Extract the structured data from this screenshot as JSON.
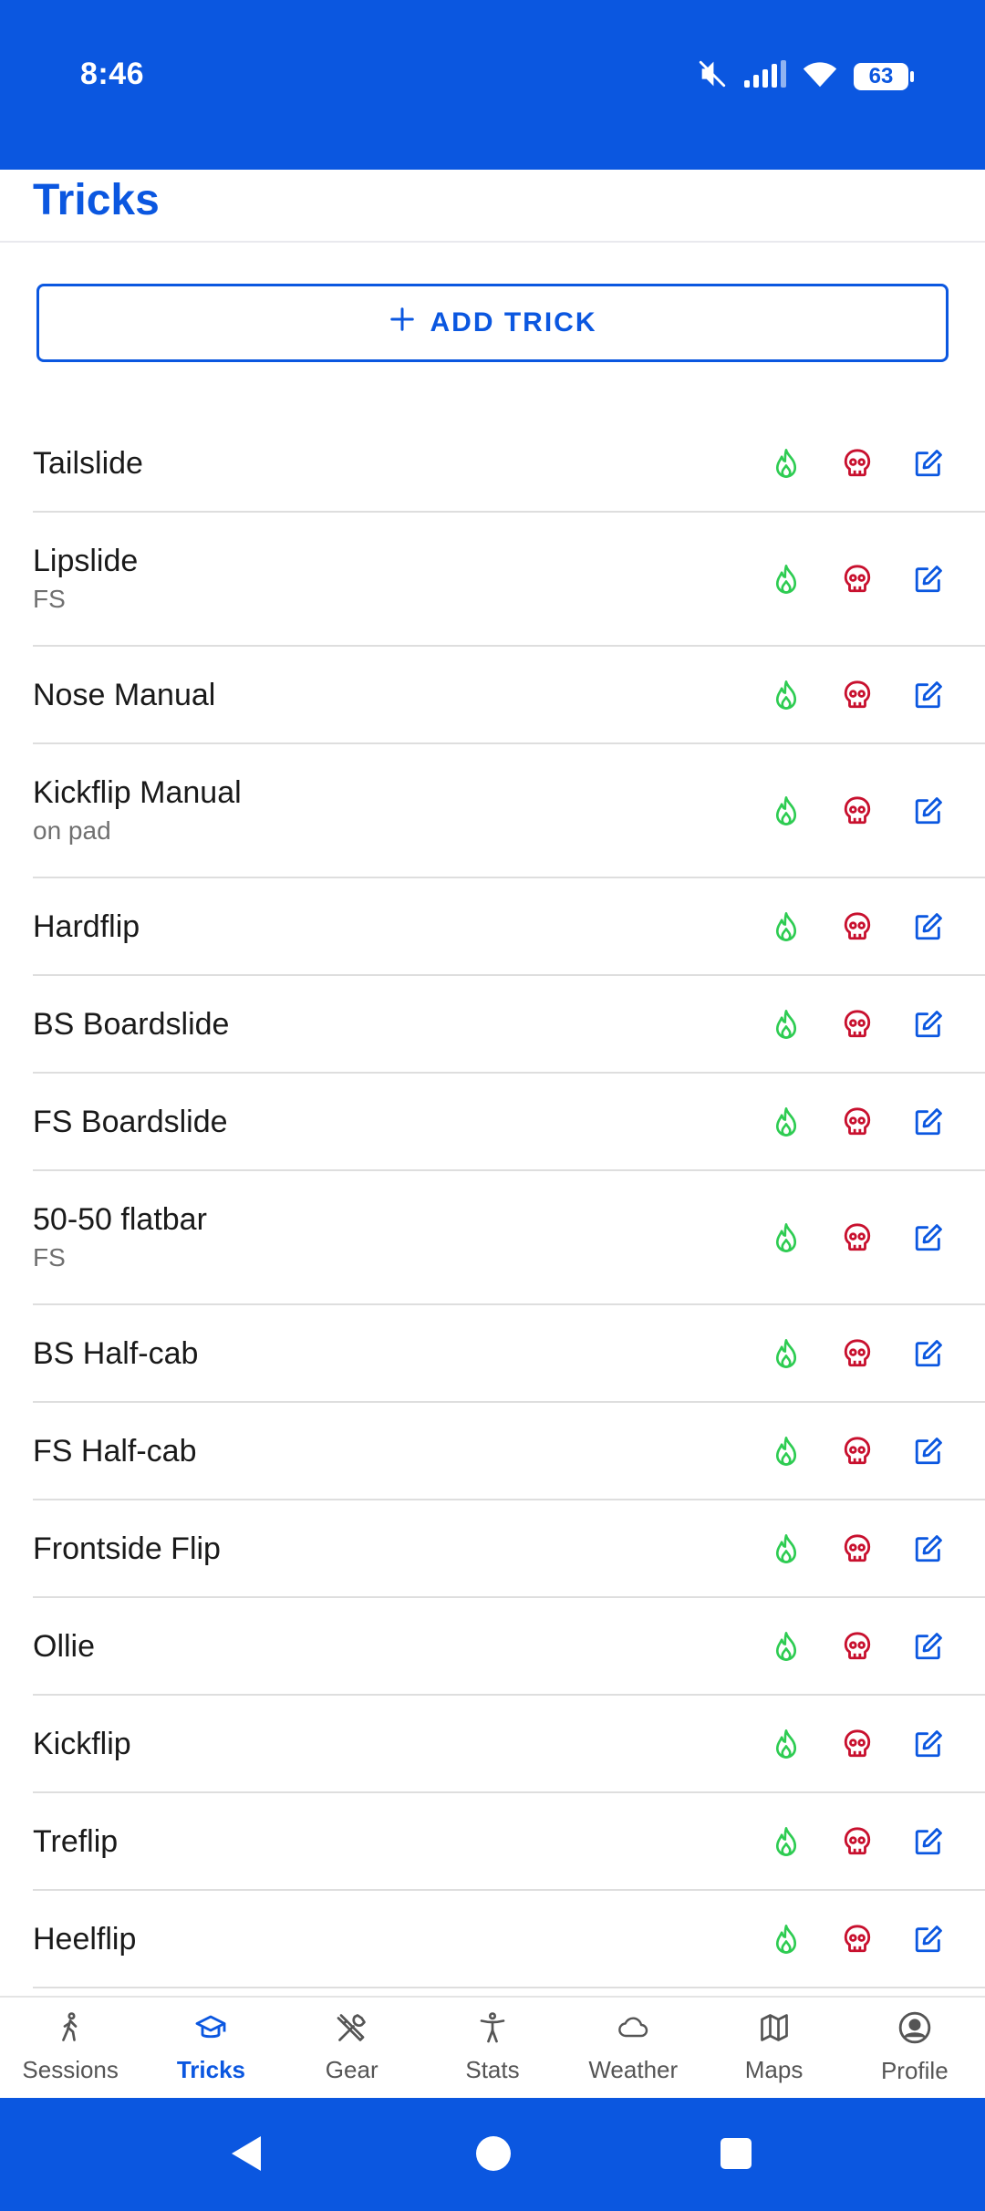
{
  "status": {
    "time": "8:46",
    "battery": "63"
  },
  "header": {
    "title": "Tricks"
  },
  "add_button": {
    "label": "ADD TRICK"
  },
  "tricks": [
    {
      "name": "Tailslide",
      "sub": ""
    },
    {
      "name": "Lipslide",
      "sub": "FS"
    },
    {
      "name": "Nose Manual",
      "sub": ""
    },
    {
      "name": "Kickflip Manual",
      "sub": "on pad"
    },
    {
      "name": "Hardflip",
      "sub": ""
    },
    {
      "name": "BS Boardslide",
      "sub": ""
    },
    {
      "name": "FS Boardslide",
      "sub": ""
    },
    {
      "name": "50-50 flatbar",
      "sub": "FS"
    },
    {
      "name": "BS Half-cab",
      "sub": ""
    },
    {
      "name": "FS Half-cab",
      "sub": ""
    },
    {
      "name": "Frontside Flip",
      "sub": ""
    },
    {
      "name": "Ollie",
      "sub": ""
    },
    {
      "name": "Kickflip",
      "sub": ""
    },
    {
      "name": "Treflip",
      "sub": ""
    },
    {
      "name": "Heelflip",
      "sub": ""
    }
  ],
  "row_icons": [
    "flame-icon",
    "skull-icon",
    "edit-icon"
  ],
  "colors": {
    "accent": "#0b57e0",
    "flame": "#2ecc52",
    "skull": "#c8102e"
  },
  "nav": [
    {
      "label": "Sessions",
      "icon": "walking-person-icon",
      "active": false
    },
    {
      "label": "Tricks",
      "icon": "graduation-cap-icon",
      "active": true
    },
    {
      "label": "Gear",
      "icon": "tools-icon",
      "active": false
    },
    {
      "label": "Stats",
      "icon": "person-figure-icon",
      "active": false
    },
    {
      "label": "Weather",
      "icon": "cloud-icon",
      "active": false
    },
    {
      "label": "Maps",
      "icon": "map-icon",
      "active": false
    },
    {
      "label": "Profile",
      "icon": "user-circle-icon",
      "active": false
    }
  ]
}
